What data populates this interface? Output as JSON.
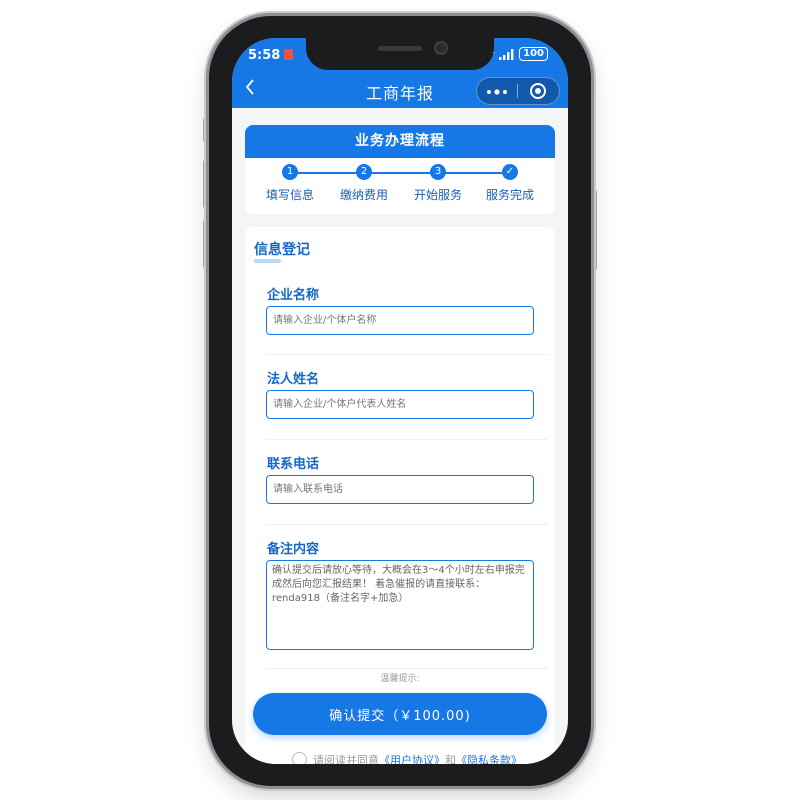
{
  "status_bar": {
    "time": "5:58",
    "battery": "100"
  },
  "nav": {
    "back_icon": "chevron-left",
    "title": "工商年报",
    "more_icon": "more-dots",
    "target_icon": "target"
  },
  "process": {
    "title": "业务办理流程",
    "steps": [
      {
        "number": "1",
        "label": "填写信息"
      },
      {
        "number": "2",
        "label": "缴纳费用"
      },
      {
        "number": "3",
        "label": "开始服务"
      },
      {
        "number": "✓",
        "label": "服务完成"
      }
    ]
  },
  "form": {
    "section_title": "信息登记",
    "company": {
      "label": "企业名称",
      "placeholder": "请输入企业/个体户名称"
    },
    "legal": {
      "label": "法人姓名",
      "placeholder": "请输入企业/个体户代表人姓名"
    },
    "phone": {
      "label": "联系电话",
      "placeholder": "请输入联系电话"
    },
    "remark": {
      "label": "备注内容",
      "value": "确认提交后请放心等待，大概会在3～4个小时左右申报完成然后向您汇报结果！ 着急催报的请直接联系：renda918（备注名字+加急）"
    },
    "tip": "温馨提示:"
  },
  "submit": {
    "label": "确认提交（￥100.00)"
  },
  "agreement": {
    "prefix": "请阅读并同意",
    "user_agreement": "《用户协议》",
    "and": "和",
    "privacy_policy": "《隐私条款》"
  },
  "colors": {
    "primary": "#1677e6",
    "label_blue": "#1567c9",
    "page_bg": "#f4f5f7"
  }
}
